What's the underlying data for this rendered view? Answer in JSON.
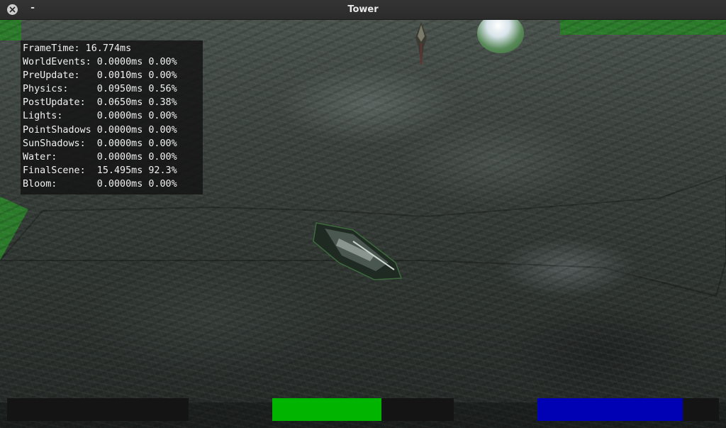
{
  "window": {
    "title": "Tower",
    "close_icon": "close-icon",
    "minimize_label": "-"
  },
  "stats": {
    "rows": [
      "FrameTime: 16.774ms",
      "WorldEvents: 0.0000ms 0.00%",
      "PreUpdate:   0.0010ms 0.00%",
      "Physics:     0.0950ms 0.56%",
      "PostUpdate:  0.0650ms 0.38%",
      "Lights:      0.0000ms 0.00%",
      "PointShadows 0.0000ms 0.00%",
      "SunShadows:  0.0000ms 0.00%",
      "Water:       0.0000ms 0.00%",
      "FinalScene:  15.495ms 92.3%",
      "Bloom:       0.0000ms 0.00%"
    ]
  },
  "hud": {
    "bars": [
      {
        "name": "left-bar",
        "fill": 0.0,
        "color": "#000000"
      },
      {
        "name": "health-bar",
        "fill": 0.6,
        "color": "#00b400"
      },
      {
        "name": "energy-bar",
        "fill": 0.8,
        "color": "#0000b4"
      }
    ]
  },
  "colors": {
    "titlebar": "#2f2f2f",
    "grass": "#2a7a2a",
    "stats_bg": "#121212",
    "bar_track": "#141414"
  }
}
